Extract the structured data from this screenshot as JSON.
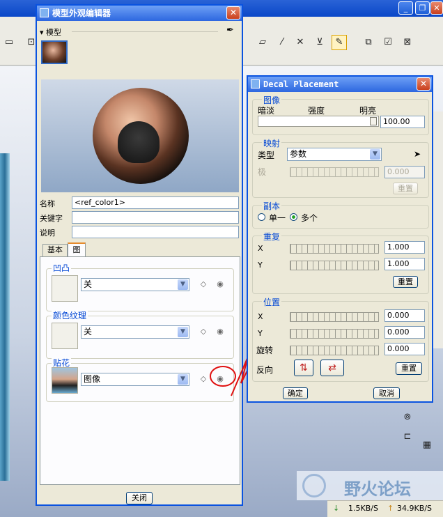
{
  "appearance_editor": {
    "title": "模型外观编辑器",
    "section_label": "模型",
    "name_label": "名称",
    "name_value": "<ref_color1>",
    "keyword_label": "关键字",
    "keyword_value": "",
    "desc_label": "说明",
    "desc_value": "",
    "tabs": [
      "基本",
      "图"
    ],
    "bump": {
      "label": "凹凸",
      "value": "关"
    },
    "color_texture": {
      "label": "颜色纹理",
      "value": "关"
    },
    "decal": {
      "label": "贴花",
      "value": "图像"
    },
    "close_label": "关闭"
  },
  "decal_placement": {
    "title": "Decal Placement",
    "image_group": "图像",
    "dim_label": "暗淡",
    "intensity_label": "强度",
    "bright_label": "明亮",
    "intensity_value": "100.00",
    "intensity_fraction": 1.0,
    "mapping_group": "映射",
    "type_label": "类型",
    "type_value": "参数",
    "pole_label": "极",
    "pole_value": "0.000",
    "reset_label": "重置",
    "copies_group": "副本",
    "single_label": "单一",
    "multiple_label": "多个",
    "copies_selected": "多个",
    "repeat_group": "重复",
    "x_label": "X",
    "y_label": "Y",
    "repeat_x": "1.000",
    "repeat_y": "1.000",
    "position_group": "位置",
    "pos_x": "0.000",
    "pos_y": "0.000",
    "rotate_label": "旋转",
    "rotate_value": "0.000",
    "flip_label": "反向",
    "ok_label": "确定",
    "cancel_label": "取消"
  },
  "status": {
    "down": "1.5KB/S",
    "up": "34.9KB/S"
  },
  "watermark": "野火论坛",
  "colors": {
    "title_blue": "#2d67e0",
    "group_label": "#0046d5",
    "annotation_red": "#e01010"
  }
}
